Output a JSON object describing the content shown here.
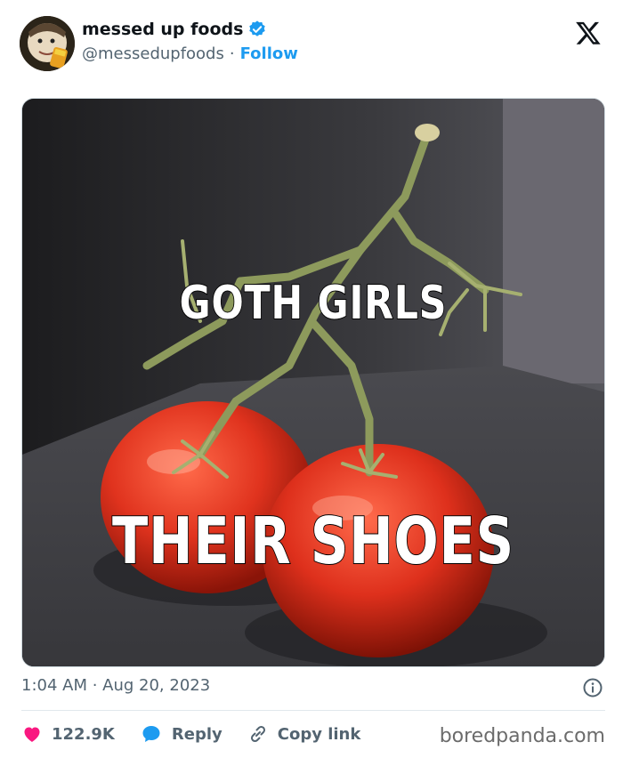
{
  "author": {
    "display_name": "messed up foods",
    "handle": "@messedupfoods",
    "separator": "·",
    "follow_label": "Follow"
  },
  "icons": {
    "verified": "verified-badge-icon",
    "platform_logo": "x-logo-icon",
    "info": "info-icon",
    "like": "heart-icon",
    "reply": "speech-bubble-icon",
    "copy": "link-icon"
  },
  "meme": {
    "top_text": "GOTH GIRLS",
    "bottom_text": "THEIR SHOES"
  },
  "timestamp": "1:04 AM · Aug 20, 2023",
  "actions": {
    "likes": "122.9K",
    "reply_label": "Reply",
    "copy_label": "Copy link"
  },
  "watermark": "boredpanda.com",
  "colors": {
    "accent": "#1d9bf0",
    "like": "#f91880",
    "text_secondary": "#536471"
  }
}
